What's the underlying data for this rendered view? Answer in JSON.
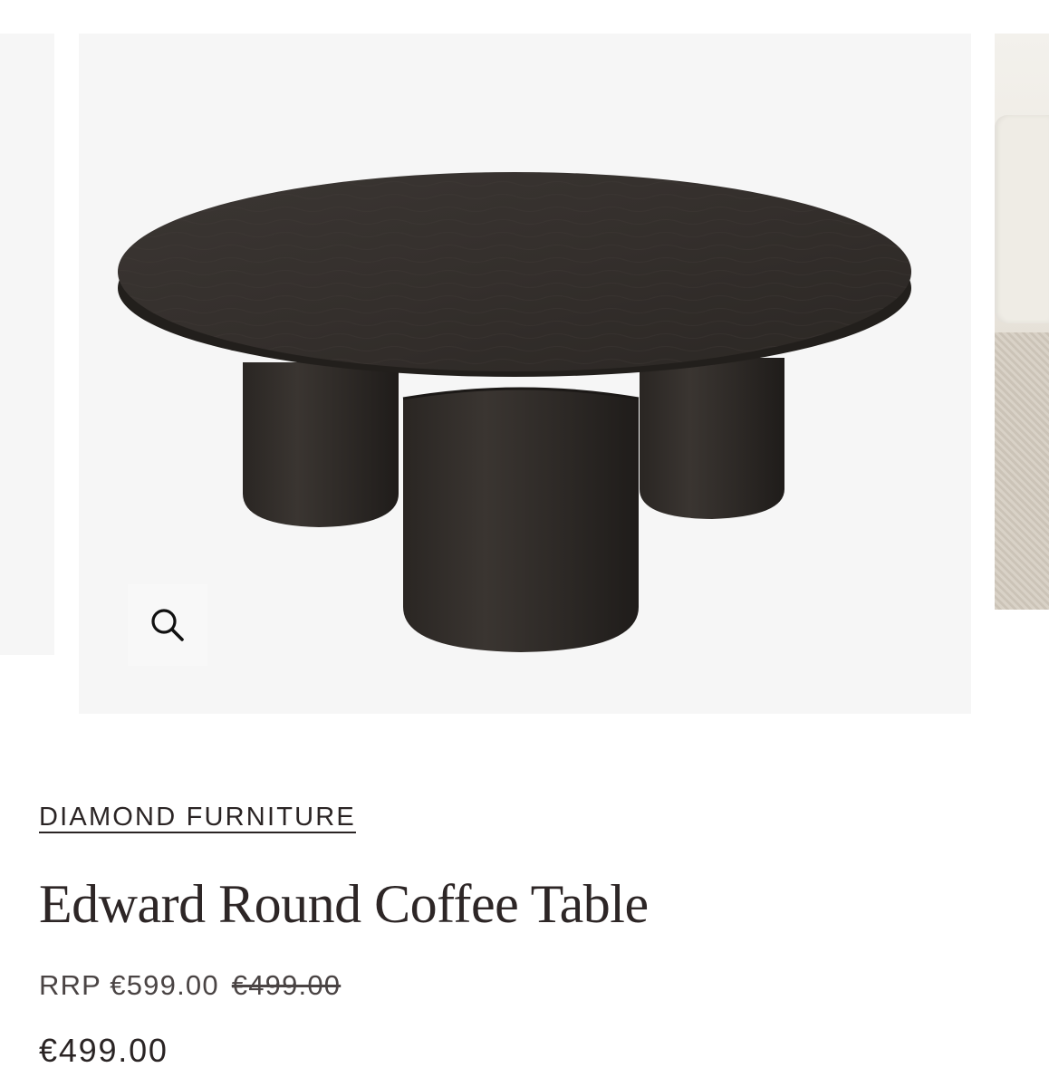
{
  "gallery": {
    "zoom_icon": "magnifier-icon",
    "main_image_alt": "Edward Round Coffee Table product photo",
    "colors": {
      "slide_background": "#f6f6f6",
      "table_wood": "#2e2a27"
    }
  },
  "product": {
    "brand": "DIAMOND FURNITURE",
    "title": "Edward Round Coffee Table",
    "rrp_label": "RRP €599.00",
    "compare_price": "€499.00",
    "price": "€499.00"
  }
}
